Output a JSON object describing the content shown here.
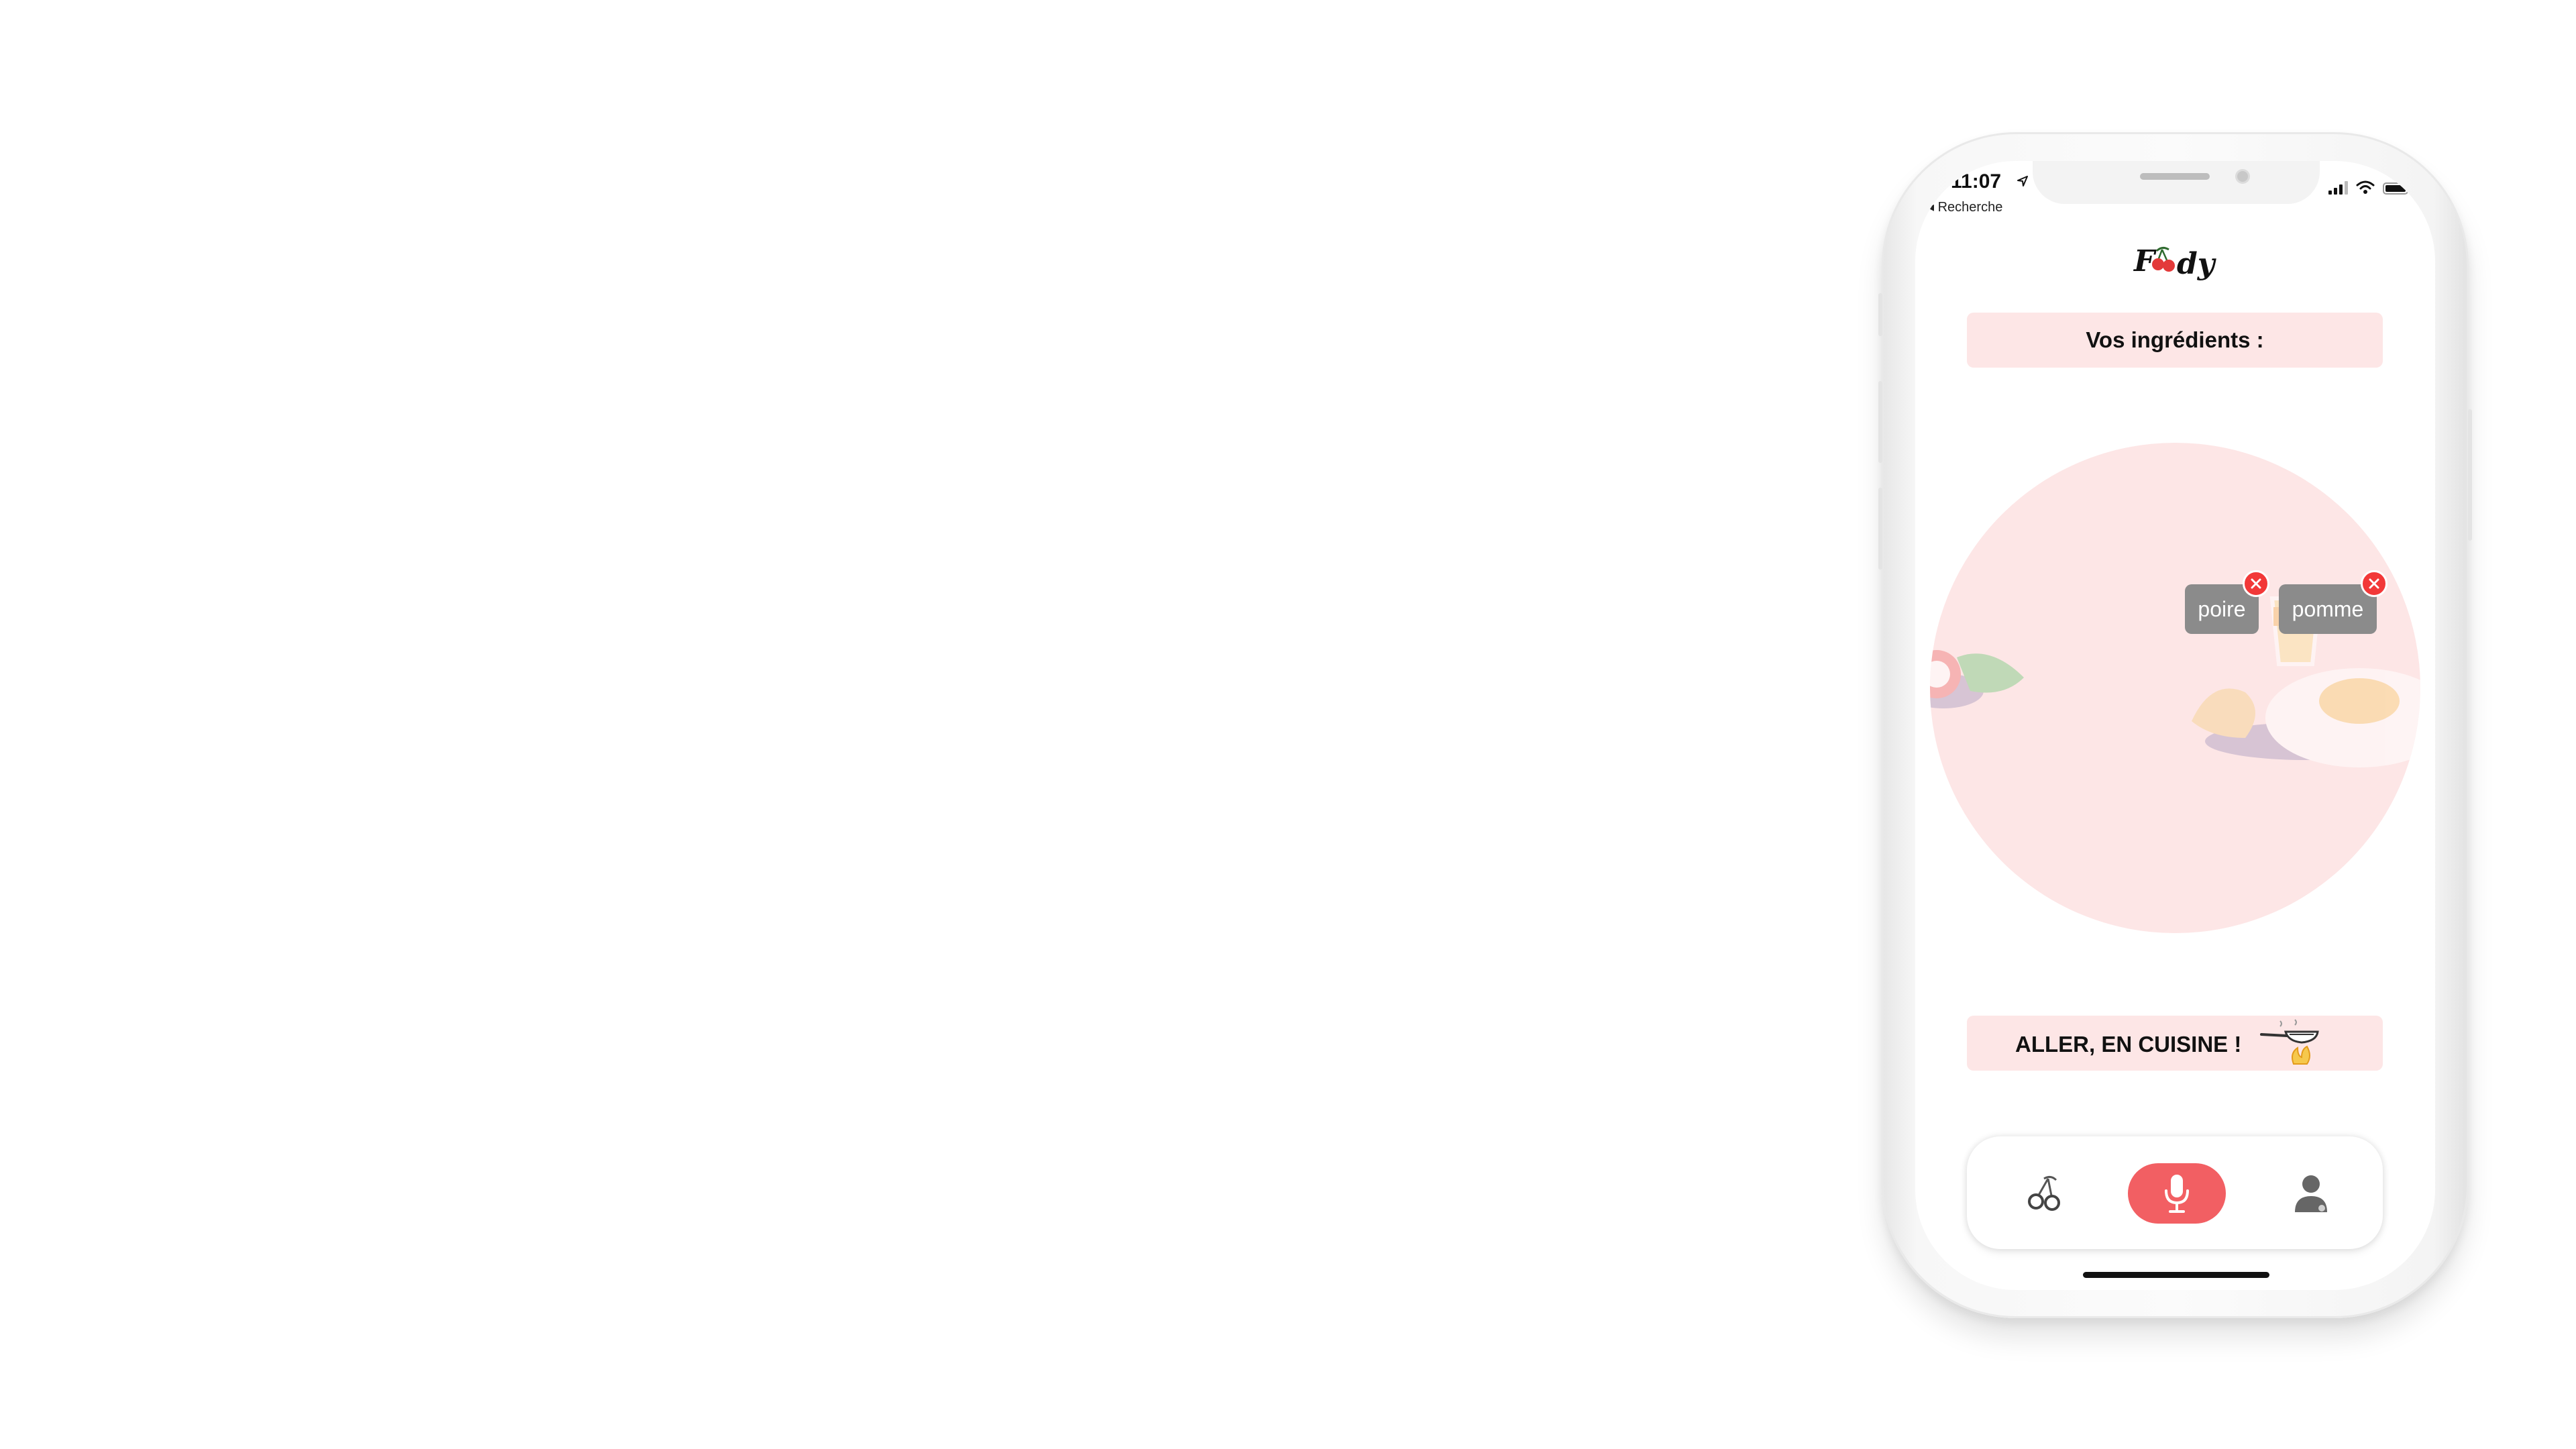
{
  "status_bar": {
    "time": "11:07",
    "back_label": "◂ Recherche",
    "icons": [
      "location-arrow-icon",
      "cellular-signal-icon",
      "wifi-icon",
      "battery-icon"
    ]
  },
  "header": {
    "logo_text": "Foody",
    "logo_icon": "cherry-icon"
  },
  "ingredients": {
    "title": "Vos ingrédients :",
    "items": [
      {
        "label": "poire",
        "remove_icon": "close-circle-icon"
      },
      {
        "label": "pomme",
        "remove_icon": "close-circle-icon"
      }
    ]
  },
  "cta": {
    "label": "ALLER, EN CUISINE  !",
    "icon": "frying-pan-icon"
  },
  "tab_bar": {
    "tabs": [
      {
        "name": "cherries",
        "icon": "cherries-icon",
        "active": false
      },
      {
        "name": "microphone",
        "icon": "microphone-icon",
        "active": true
      },
      {
        "name": "profile",
        "icon": "user-icon",
        "active": false
      }
    ]
  },
  "colors": {
    "accent": "#f25f63",
    "pink_background": "#fde6e6",
    "chip_background": "#8b8b8b",
    "remove_badge": "#f23838"
  }
}
